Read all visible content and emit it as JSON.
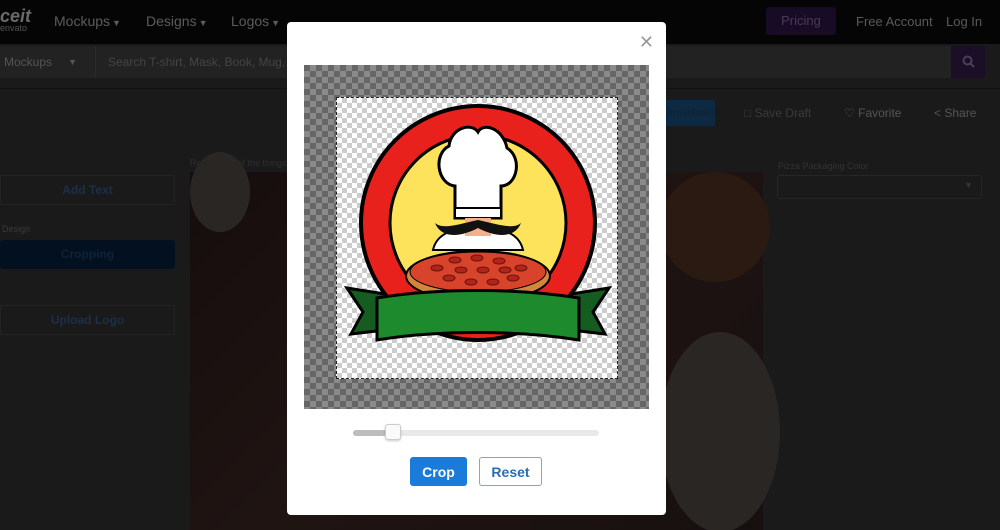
{
  "header": {
    "logo_main": "ceit",
    "logo_sub": "envato",
    "nav": [
      {
        "label": "Mockups"
      },
      {
        "label": "Designs"
      },
      {
        "label": "Logos"
      }
    ],
    "pricing_label": "Pricing",
    "free_account_label": "Free Account",
    "login_label": "Log In"
  },
  "search": {
    "category": "Mockups",
    "placeholder": "Search T-shirt, Mask, Book, Mug, H",
    "button_icon": "search-icon"
  },
  "sidebar": {
    "add_text_label": "Add Text",
    "design_label": "Design",
    "cropping_label": "Cropping",
    "upload_logo_label": "Upload Logo"
  },
  "preview": {
    "caption": "Remove all of the things from"
  },
  "actions": {
    "primary_label": "Download",
    "save_draft_label": "Save Draft",
    "favorite_label": "Favorite",
    "share_label": "Share"
  },
  "options": {
    "field_label": "Pizza Packaging Color",
    "select_value": ""
  },
  "modal": {
    "close_icon": "close-icon",
    "image_alt": "Pizza chef logo",
    "zoom_slider_value": 0.14,
    "crop_label": "Crop",
    "reset_label": "Reset",
    "colors": {
      "crop_button": "#1a7bd8",
      "reset_text": "#2a6db4",
      "badge_red": "#e8211c",
      "badge_yellow": "#fde25c",
      "ribbon_green": "#1e8a2e",
      "ribbon_dark_green": "#155c20"
    }
  }
}
